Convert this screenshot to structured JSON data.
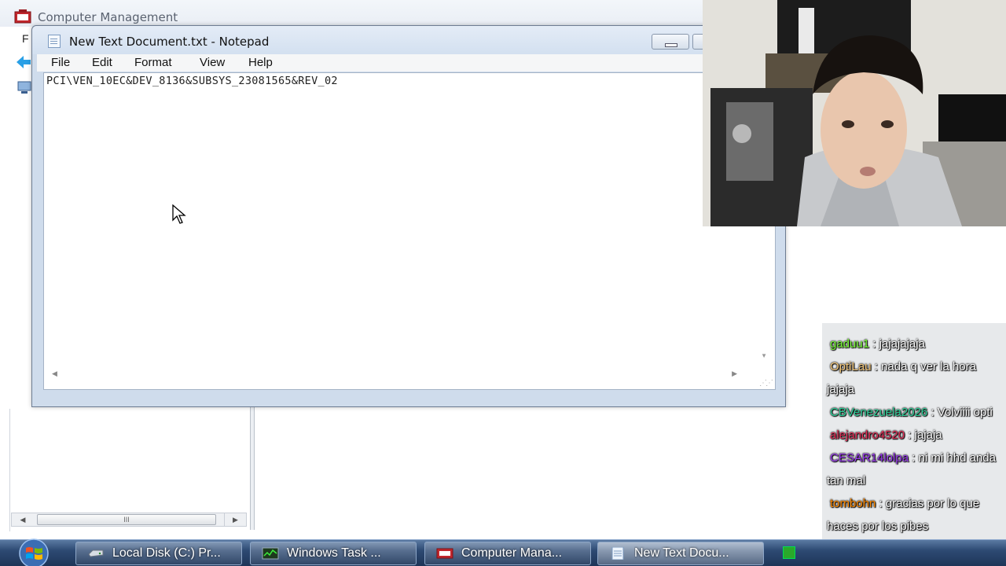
{
  "computer_management": {
    "title": "Computer Management",
    "menu_first_letter": "F",
    "scroll_thumb_glyph": "III"
  },
  "notepad": {
    "title": "New Text Document.txt - Notepad",
    "menu": [
      "File",
      "Edit",
      "Format",
      "View",
      "Help"
    ],
    "content": "PCI\\VEN_10EC&DEV_8136&SUBSYS_23081565&REV_02"
  },
  "chat": {
    "messages": [
      {
        "user": "gaduu1",
        "text": "jajajajaja",
        "color": "#7cff3a"
      },
      {
        "user": "OptiLau",
        "text": "nada q ver la hora jajaja",
        "color": "#f4c77a"
      },
      {
        "user": "CBVenezuela2026",
        "text": "Volviiii opti",
        "color": "#2fd19a"
      },
      {
        "user": "alejandro4520",
        "text": "jajaja",
        "color": "#e8305a"
      },
      {
        "user": "CESAR14lolpa",
        "text": "ni mi hhd anda tan mal",
        "color": "#9b3cf0"
      },
      {
        "user": "tombohn",
        "text": "gracias por lo que haces por los pibes",
        "color": "#ff8a00"
      }
    ]
  },
  "taskbar": {
    "items": [
      {
        "label": "Local Disk (C:) Pr...",
        "icon": "drive-icon"
      },
      {
        "label": "Windows Task ...",
        "icon": "task-manager-icon"
      },
      {
        "label": "Computer Mana...",
        "icon": "computer-management-icon"
      },
      {
        "label": "New Text Docu...",
        "icon": "notepad-icon",
        "active": true
      }
    ]
  }
}
